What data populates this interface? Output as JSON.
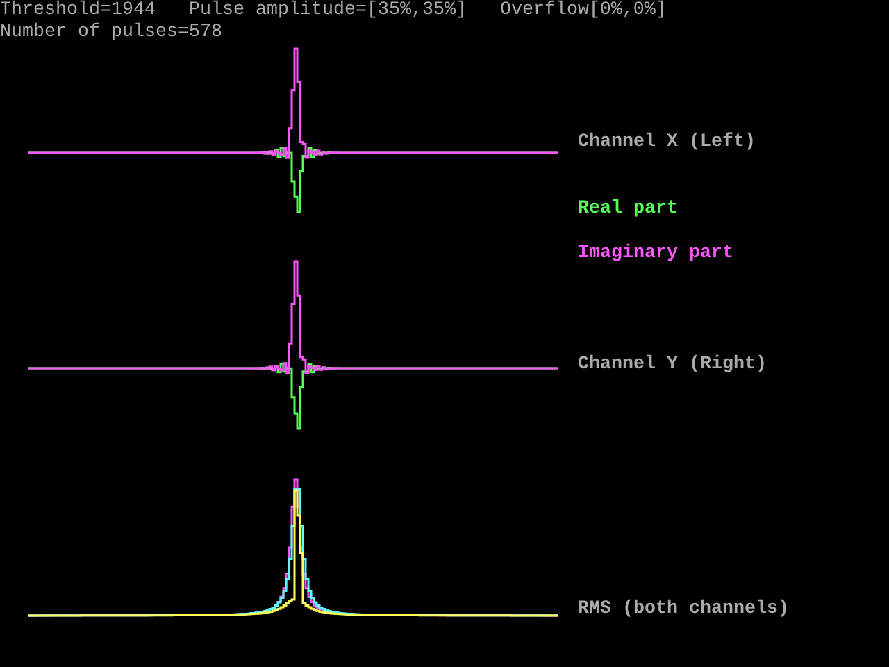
{
  "status": {
    "threshold": "Threshold=1944",
    "pulse_amplitude": "Pulse amplitude=[35%,35%]",
    "overflow": "Overflow[0%,0%]",
    "pulse_count": "Number of pulses=578"
  },
  "plots": [
    {
      "kind": "complex",
      "label": "Channel X (Left)"
    },
    {
      "kind": "complex",
      "label": "Channel Y (Right)"
    },
    {
      "kind": "rms",
      "label": "RMS (both channels)"
    }
  ],
  "legend": [
    {
      "label": "Real part",
      "color": "#55ff55"
    },
    {
      "label": "Imaginary part",
      "color": "#ff55ff"
    }
  ]
}
